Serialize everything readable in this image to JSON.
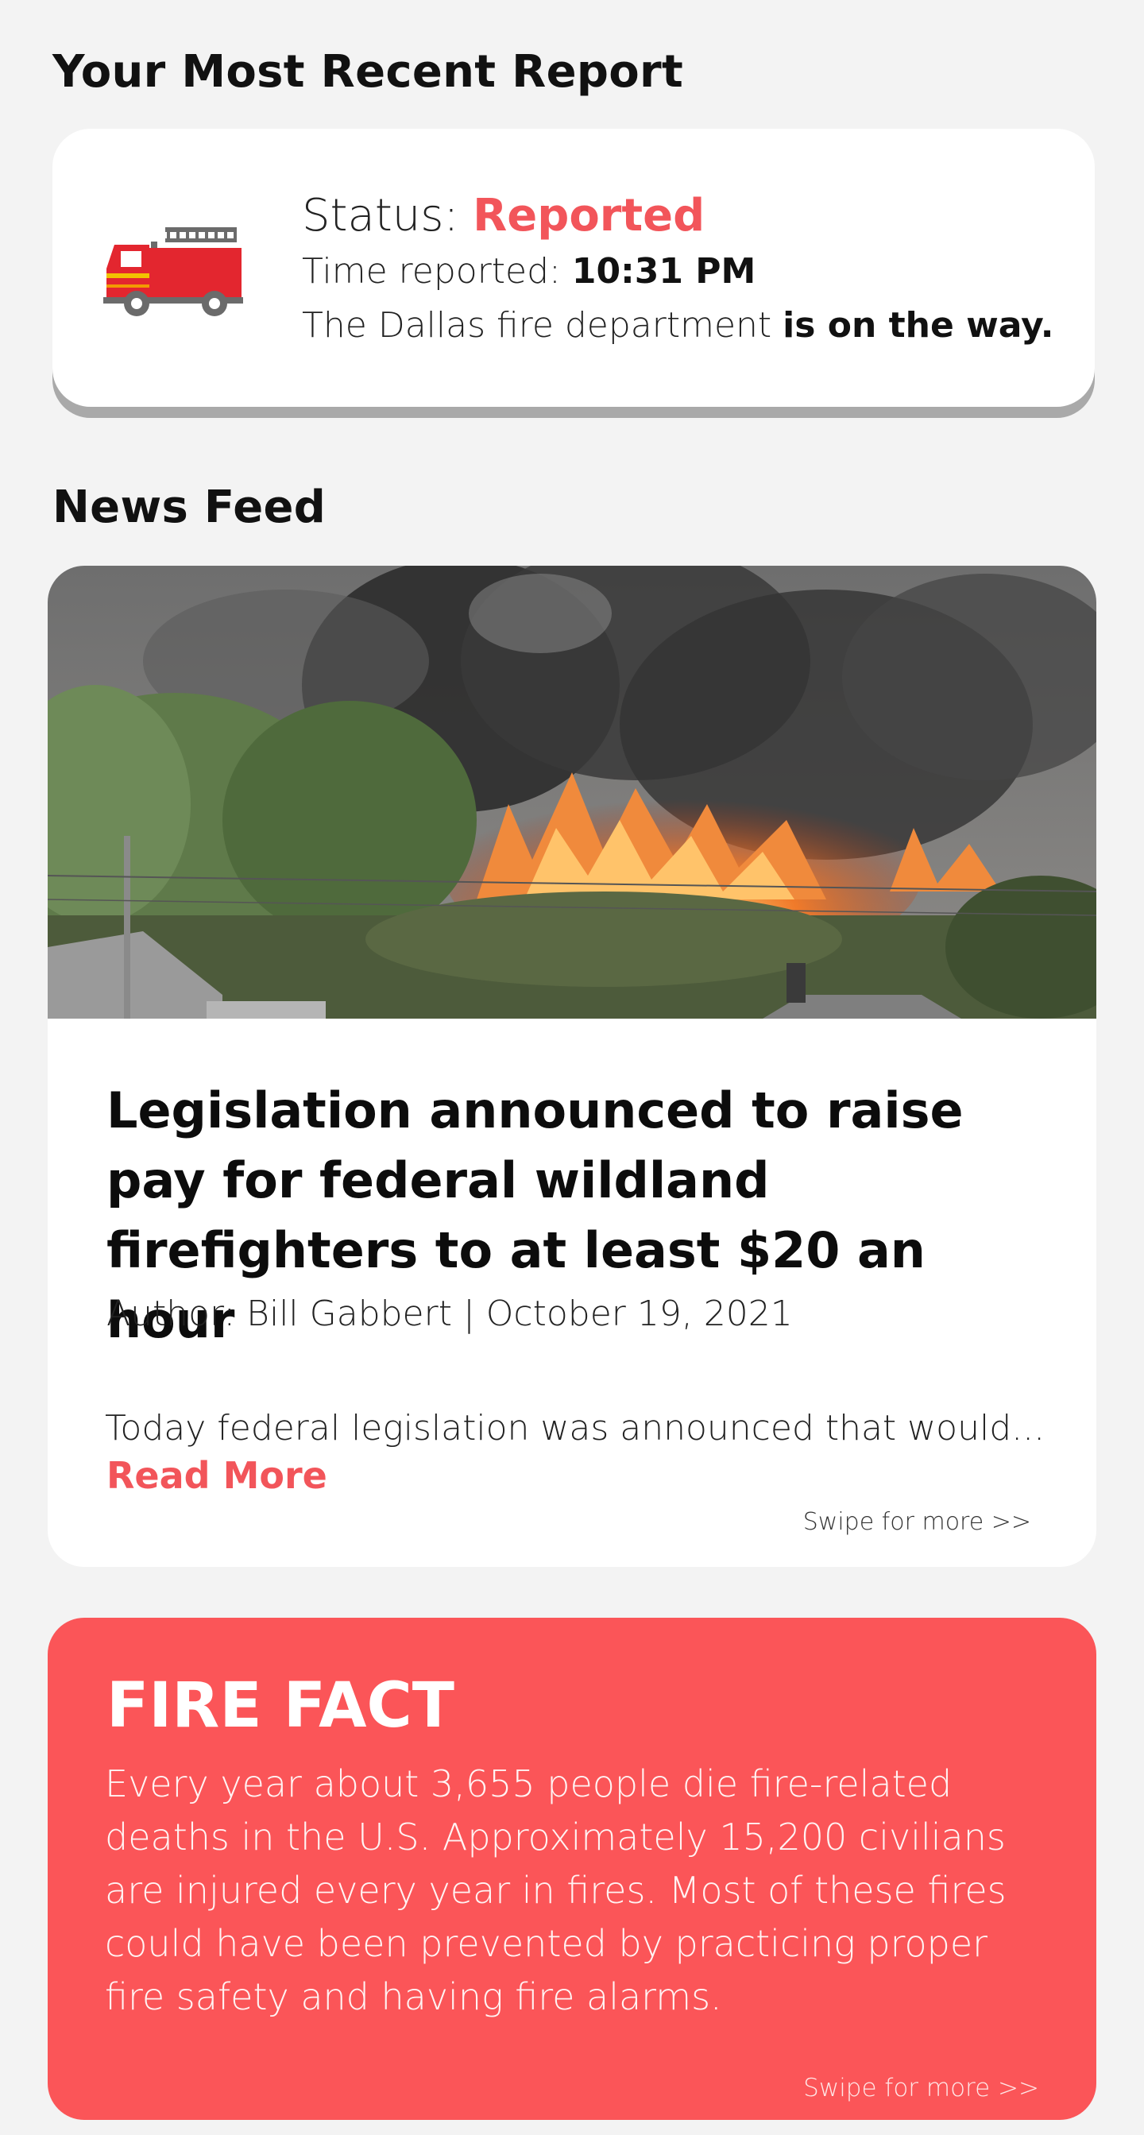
{
  "recent_report": {
    "section_title": "Your Most Recent Report",
    "status_label": "Status: ",
    "status_value": "Reported",
    "time_label": "Time reported: ",
    "time_value": "10:31 PM",
    "department_text": "The Dallas fire department ",
    "department_status": "is on the way.",
    "icon": "fire-truck-icon"
  },
  "news_feed": {
    "section_title": "News Feed",
    "article": {
      "image": "wildfire-photo",
      "headline": "Legislation announced to raise pay for federal wildland firefighters to at least $20 an hour",
      "byline": "Author: Bill Gabbert | October 19, 2021",
      "excerpt": "Today federal legislation was announced that would...",
      "read_more": "Read More"
    },
    "swipe_label": "Swipe for more >>"
  },
  "fire_fact": {
    "title": "FIRE FACT",
    "body": "Every year about 3,655 people die fire-related deaths in the U.S. Approximately 15,200 civilians are injured every year in fires. Most of these fires could have been prevented by practicing proper fire safety and having fire alarms.",
    "swipe_label": "Swipe for more >>"
  },
  "colors": {
    "accent": "#f2555a",
    "fact_background": "#fb5558",
    "page_background": "#f3f3f3"
  }
}
